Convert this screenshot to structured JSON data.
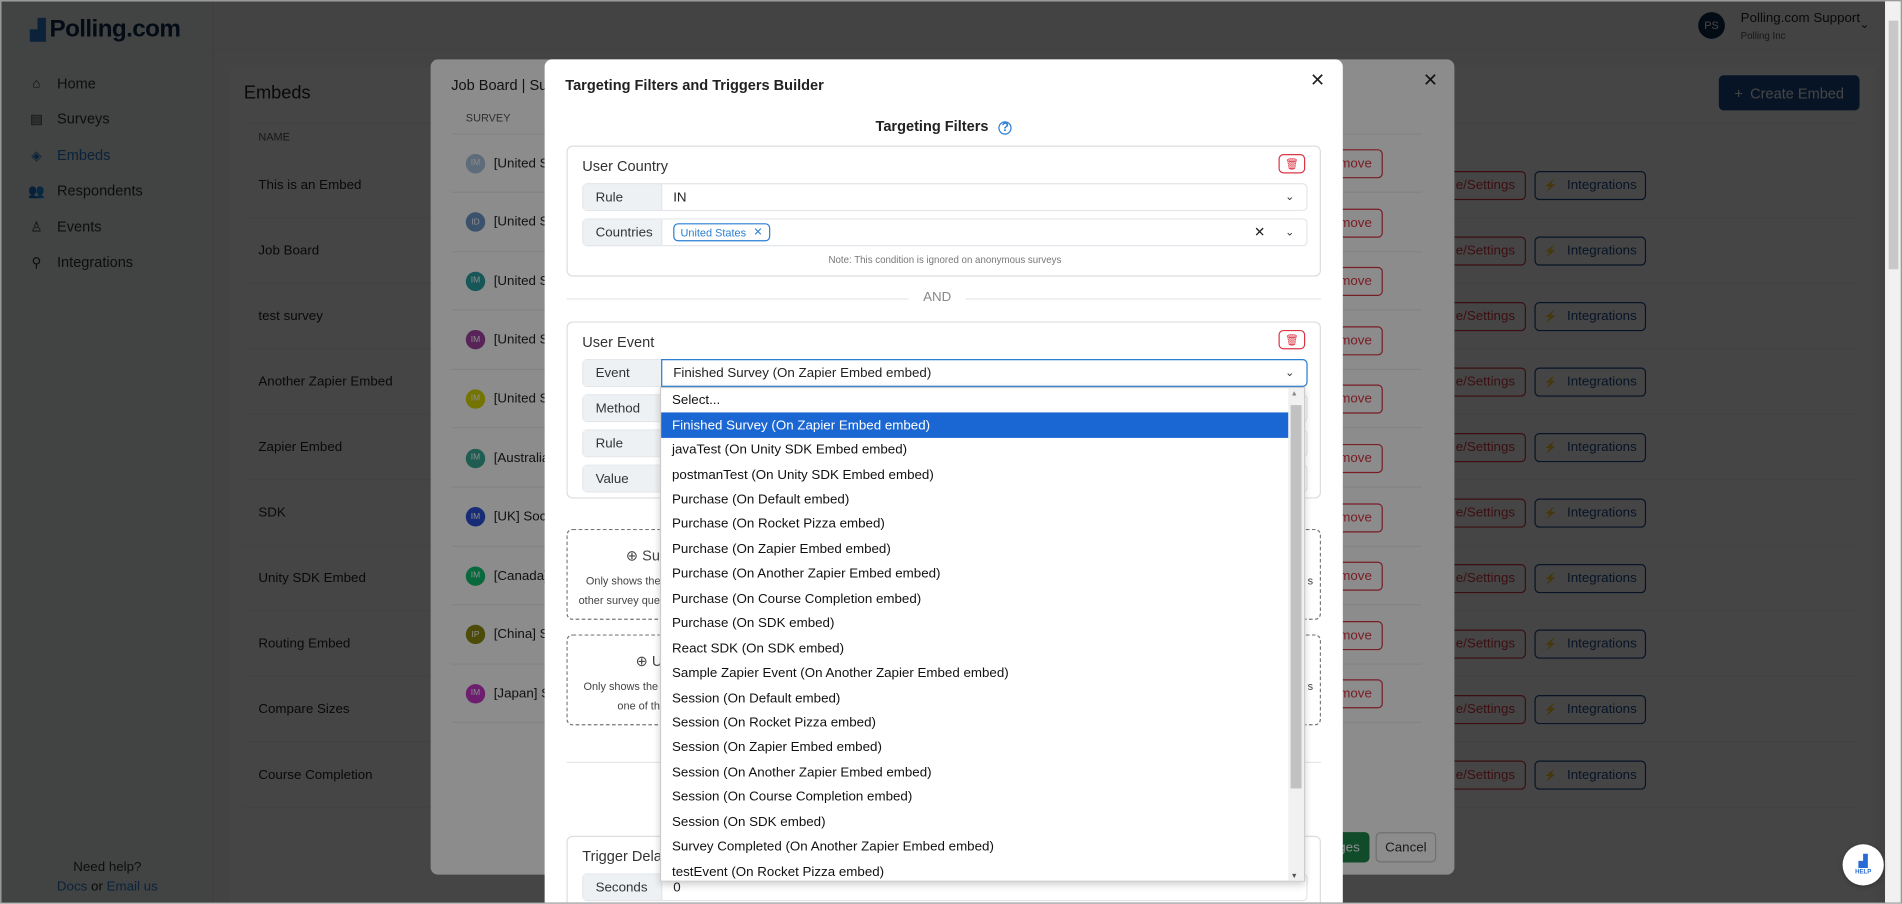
{
  "app": {
    "logo": "Polling.com",
    "user_initials": "PS",
    "user_name": "Polling.com Support",
    "org": "Polling Inc"
  },
  "sidebar": {
    "items": [
      {
        "label": "Home",
        "icon": "home-icon"
      },
      {
        "label": "Surveys",
        "icon": "surveys-icon"
      },
      {
        "label": "Embeds",
        "icon": "layers-icon",
        "active": true
      },
      {
        "label": "Respondents",
        "icon": "users-icon"
      },
      {
        "label": "Events",
        "icon": "events-icon"
      },
      {
        "label": "Integrations",
        "icon": "integrations-icon"
      }
    ],
    "help": "Need help?",
    "docs": "Docs",
    "or": "or",
    "email": "Email us"
  },
  "main": {
    "title": "Embeds",
    "create_label": "Create Embed",
    "name_header": "NAME",
    "settings_label": "e/Settings",
    "integrations_label": "Integrations",
    "embeds": [
      "This is an Embed",
      "Job Board",
      "test survey",
      "Another Zapier Embed",
      "Zapier Embed",
      "SDK",
      "Unity SDK Embed",
      "Routing Embed",
      "Compare Sizes",
      "Course Completion"
    ]
  },
  "modal1": {
    "title": "Job Board | Su",
    "survey_header": "SURVEY",
    "remove_label": "move",
    "save_label": "ges",
    "cancel_label": "Cancel",
    "rows": [
      {
        "initials": "IM",
        "text": "[United S",
        "color": "#a9c3de"
      },
      {
        "initials": "ID",
        "text": "[United S",
        "color": "#6c96c6"
      },
      {
        "initials": "IM",
        "text": "[United S",
        "color": "#2a9ea0"
      },
      {
        "initials": "IM",
        "text": "[United S",
        "color": "#a040a0"
      },
      {
        "initials": "IM",
        "text": "[United S",
        "color": "#d4d400"
      },
      {
        "initials": "IM",
        "text": "[Australia",
        "color": "#3aaa95"
      },
      {
        "initials": "IM",
        "text": "[UK] Soci",
        "color": "#2850d8"
      },
      {
        "initials": "IM",
        "text": "[Canada]",
        "color": "#10c070"
      },
      {
        "initials": "IP",
        "text": "[China] S",
        "color": "#8a8a10"
      },
      {
        "initials": "IM",
        "text": "[Japan] S",
        "color": "#c838c8"
      }
    ]
  },
  "modal2": {
    "title": "Targeting Filters and Triggers Builder",
    "section": "Targeting Filters",
    "country": {
      "title": "User Country",
      "rule_label": "Rule",
      "rule_value": "IN",
      "countries_label": "Countries",
      "tag": "United States",
      "note": "Note: This condition is ignored on anonymous surveys"
    },
    "and": "AND",
    "event": {
      "title": "User Event",
      "event_label": "Event",
      "event_value": "Finished Survey (On Zapier Embed embed)",
      "method_label": "Method",
      "rule_label": "Rule",
      "value_label": "Value"
    },
    "box1": {
      "title": "Su",
      "line1": "Only shows the",
      "line2": "other survey ques",
      "right": "s"
    },
    "box2": {
      "title": "U",
      "line1": "Only shows the s",
      "line2": "one of th",
      "right": "s"
    },
    "delay": {
      "title": "Trigger Delay",
      "seconds_label": "Seconds",
      "seconds_value": "0"
    },
    "dropdown": {
      "selected_index": 1,
      "options": [
        "Select...",
        "Finished Survey (On Zapier Embed embed)",
        "javaTest (On Unity SDK Embed embed)",
        "postmanTest (On Unity SDK Embed embed)",
        "Purchase (On Default embed)",
        "Purchase (On Rocket Pizza embed)",
        "Purchase (On Zapier Embed embed)",
        "Purchase (On Another Zapier Embed embed)",
        "Purchase (On Course Completion embed)",
        "Purchase (On SDK embed)",
        "React SDK (On SDK embed)",
        "Sample Zapier Event (On Another Zapier Embed embed)",
        "Session (On Default embed)",
        "Session (On Rocket Pizza embed)",
        "Session (On Zapier Embed embed)",
        "Session (On Another Zapier Embed embed)",
        "Session (On Course Completion embed)",
        "Session (On SDK embed)",
        "Survey Completed (On Another Zapier Embed embed)",
        "testEvent (On Rocket Pizza embed)"
      ]
    }
  },
  "help_button": "HELP",
  "colors": {
    "brand": "#0f2a4f",
    "accent": "#2a7fd4",
    "danger": "#dc3545",
    "success": "#1e8a4c",
    "highlight": "#1a66d2"
  }
}
